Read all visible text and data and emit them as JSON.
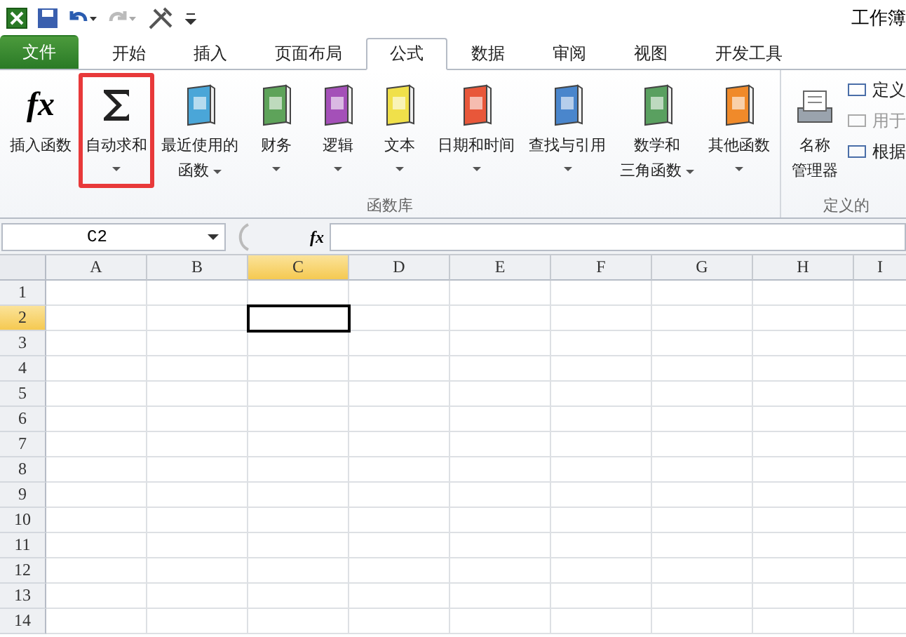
{
  "window": {
    "title": "工作簿"
  },
  "tabs": [
    {
      "label": "文件",
      "kind": "file",
      "selected": false
    },
    {
      "label": "开始",
      "kind": "tab",
      "selected": false
    },
    {
      "label": "插入",
      "kind": "tab",
      "selected": false
    },
    {
      "label": "页面布局",
      "kind": "tab",
      "selected": false
    },
    {
      "label": "公式",
      "kind": "tab",
      "selected": true
    },
    {
      "label": "数据",
      "kind": "tab",
      "selected": false
    },
    {
      "label": "审阅",
      "kind": "tab",
      "selected": false
    },
    {
      "label": "视图",
      "kind": "tab",
      "selected": false
    },
    {
      "label": "开发工具",
      "kind": "tab",
      "selected": false
    }
  ],
  "ribbon": {
    "groups": [
      {
        "label": "函数库",
        "buttons": [
          {
            "lines": [
              "插入函数"
            ],
            "icon_text": "fx",
            "dropdown": false,
            "highlighted": false
          },
          {
            "lines": [
              "自动求和"
            ],
            "dropdown": true,
            "highlighted": true
          },
          {
            "lines": [
              "最近使用的",
              "函数"
            ],
            "dropdown": true,
            "highlighted": false
          },
          {
            "lines": [
              "财务"
            ],
            "dropdown": true,
            "highlighted": false
          },
          {
            "lines": [
              "逻辑"
            ],
            "dropdown": true,
            "highlighted": false
          },
          {
            "lines": [
              "文本"
            ],
            "dropdown": true,
            "highlighted": false
          },
          {
            "lines": [
              "日期和时间"
            ],
            "dropdown": true,
            "highlighted": false
          },
          {
            "lines": [
              "查找与引用"
            ],
            "dropdown": true,
            "highlighted": false
          },
          {
            "lines": [
              "数学和",
              "三角函数"
            ],
            "dropdown": true,
            "highlighted": false
          },
          {
            "lines": [
              "其他函数"
            ],
            "dropdown": true,
            "highlighted": false
          }
        ]
      },
      {
        "label": "定义的",
        "buttons": [
          {
            "lines": [
              "名称",
              "管理器"
            ],
            "dropdown": false,
            "highlighted": false
          }
        ],
        "small_buttons": [
          {
            "label": "定义",
            "disabled": false
          },
          {
            "label": "用于",
            "disabled": true
          },
          {
            "label": "根据",
            "disabled": false
          }
        ]
      }
    ]
  },
  "formula_bar": {
    "name_box": "C2",
    "fx_label": "fx"
  },
  "sheet": {
    "columns": [
      {
        "label": "A",
        "selected": false
      },
      {
        "label": "B",
        "selected": false
      },
      {
        "label": "C",
        "selected": true
      },
      {
        "label": "D",
        "selected": false
      },
      {
        "label": "E",
        "selected": false
      },
      {
        "label": "F",
        "selected": false
      },
      {
        "label": "G",
        "selected": false
      },
      {
        "label": "H",
        "selected": false
      },
      {
        "label": "I",
        "selected": false
      }
    ],
    "rows": [
      {
        "label": "1",
        "selected": false
      },
      {
        "label": "2",
        "selected": true
      },
      {
        "label": "3",
        "selected": false
      },
      {
        "label": "4",
        "selected": false
      },
      {
        "label": "5",
        "selected": false
      },
      {
        "label": "6",
        "selected": false
      },
      {
        "label": "7",
        "selected": false
      },
      {
        "label": "8",
        "selected": false
      },
      {
        "label": "9",
        "selected": false
      },
      {
        "label": "10",
        "selected": false
      },
      {
        "label": "11",
        "selected": false
      },
      {
        "label": "12",
        "selected": false
      },
      {
        "label": "13",
        "selected": false
      },
      {
        "label": "14",
        "selected": false
      }
    ]
  }
}
